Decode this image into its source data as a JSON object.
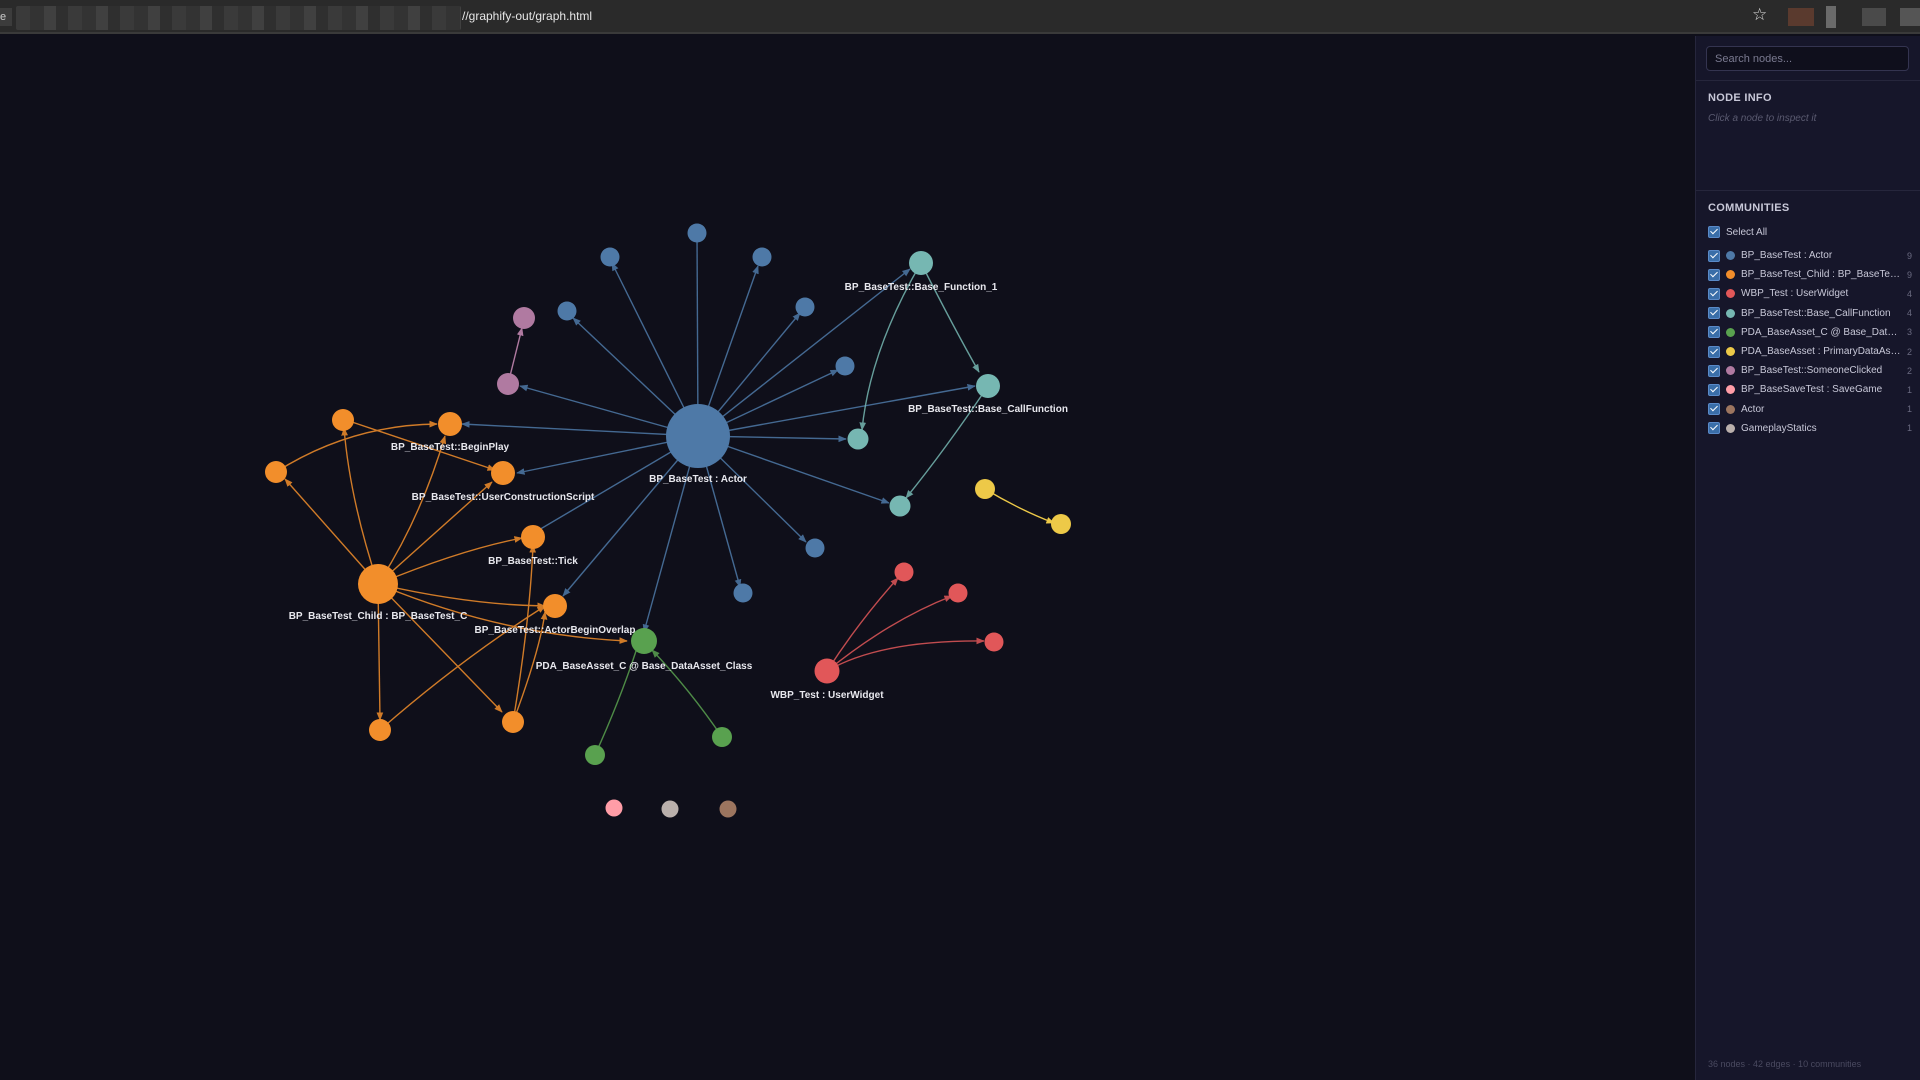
{
  "browser": {
    "url": "//graphify-out/graph.html",
    "tab_edge": "e",
    "star_icon": "star-icon"
  },
  "sidebar": {
    "search_placeholder": "Search nodes...",
    "node_info_title": "NODE INFO",
    "node_info_hint": "Click a node to inspect it",
    "communities_title": "COMMUNITIES",
    "select_all_label": "Select All",
    "communities": [
      {
        "name": "BP_BaseTest : Actor",
        "count": "9",
        "color": "#4e79a7"
      },
      {
        "name": "BP_BaseTest_Child : BP_BaseTest_C",
        "count": "9",
        "color": "#f28e2b"
      },
      {
        "name": "WBP_Test : UserWidget",
        "count": "4",
        "color": "#e15759"
      },
      {
        "name": "BP_BaseTest::Base_CallFunction",
        "count": "4",
        "color": "#76b7b2"
      },
      {
        "name": "PDA_BaseAsset_C @ Base_DataAsset_Class",
        "count": "3",
        "color": "#59a14f"
      },
      {
        "name": "PDA_BaseAsset : PrimaryDataAsset",
        "count": "2",
        "color": "#edc948"
      },
      {
        "name": "BP_BaseTest::SomeoneClicked",
        "count": "2",
        "color": "#b07aa1"
      },
      {
        "name": "BP_BaseSaveTest : SaveGame",
        "count": "1",
        "color": "#ff9da7"
      },
      {
        "name": "Actor",
        "count": "1",
        "color": "#9c755f"
      },
      {
        "name": "GameplayStatics",
        "count": "1",
        "color": "#bab0ac"
      }
    ],
    "stats": "36 nodes · 42 edges · 10 communities"
  },
  "graph": {
    "colors": {
      "blue": "#4e79a7",
      "orange": "#f28e2b",
      "red": "#e15759",
      "teal": "#76b7b2",
      "green": "#59a14f",
      "yellow": "#edc948",
      "purple": "#b07aa1",
      "pink": "#ff9da7",
      "brown": "#9c755f",
      "grey": "#bab0ac"
    },
    "labels": {
      "actor": "BP_BaseTest : Actor",
      "base_function_1": "BP_BaseTest::Base_Function_1",
      "base_callfunction": "BP_BaseTest::Base_CallFunction",
      "beginplay": "BP_BaseTest::BeginPlay",
      "construction": "BP_BaseTest::UserConstructionScript",
      "tick": "BP_BaseTest::Tick",
      "child": "BP_BaseTest_Child : BP_BaseTest_C",
      "overlap": "BP_BaseTest::ActorBeginOverlap",
      "pda": "PDA_BaseAsset_C @ Base_DataAsset_Class",
      "wbp": "WBP_Test : UserWidget"
    }
  }
}
